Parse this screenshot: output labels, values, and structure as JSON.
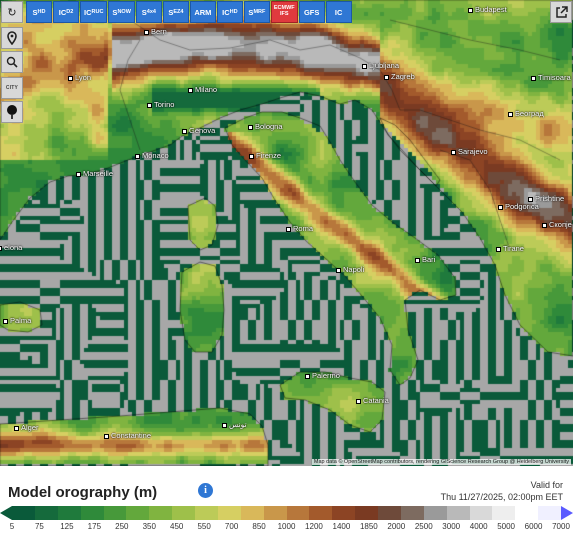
{
  "map": {
    "cities": [
      {
        "name": "Bern",
        "key": "bern"
      },
      {
        "name": "Budapest",
        "key": "budapest"
      },
      {
        "name": "Lyon",
        "key": "lyon"
      },
      {
        "name": "Milano",
        "key": "milano"
      },
      {
        "name": "Ljubljana",
        "key": "ljubljana"
      },
      {
        "name": "Zagreb",
        "key": "zagreb"
      },
      {
        "name": "Timisoara",
        "key": "timisoara"
      },
      {
        "name": "Torino",
        "key": "torino"
      },
      {
        "name": "Београд",
        "key": "beograd"
      },
      {
        "name": "Genova",
        "key": "genova"
      },
      {
        "name": "Bologna",
        "key": "bologna"
      },
      {
        "name": "Monaco",
        "key": "monaco"
      },
      {
        "name": "Firenze",
        "key": "firenze"
      },
      {
        "name": "Sarajevo",
        "key": "sarajevo"
      },
      {
        "name": "Marseille",
        "key": "marseille"
      },
      {
        "name": "Podgorica",
        "key": "podgorica"
      },
      {
        "name": "Prishtine",
        "key": "prishtine"
      },
      {
        "name": "Roma",
        "key": "roma"
      },
      {
        "name": "Скопје",
        "key": "skopje"
      },
      {
        "name": "Tirane",
        "key": "tirane"
      },
      {
        "name": "Bari",
        "key": "bari"
      },
      {
        "name": "Napoli",
        "key": "napoli"
      },
      {
        "name": "elona",
        "key": "barcelona"
      },
      {
        "name": "Palma",
        "key": "palma"
      },
      {
        "name": "Palermo",
        "key": "palermo"
      },
      {
        "name": "Catania",
        "key": "catania"
      },
      {
        "name": "Alger",
        "key": "alger"
      },
      {
        "name": "Constantine",
        "key": "constantine"
      },
      {
        "name": "تونس",
        "key": "tunis"
      }
    ],
    "attribution": "Map data © OpenStreetMap contributors, rendering GIScience Research Group @ Heidelberg University"
  },
  "toolbar": {
    "models": [
      {
        "main": "S",
        "sub": "HD",
        "active": false
      },
      {
        "main": "IC",
        "sub": "D2",
        "active": false
      },
      {
        "main": "IC",
        "sub": "RUC",
        "active": false
      },
      {
        "main": "S",
        "sub": "NOW",
        "active": false
      },
      {
        "main": "S",
        "sub": "4x4",
        "active": false
      },
      {
        "main": "S",
        "sub": "EZ4",
        "active": false
      },
      {
        "main": "ARM",
        "sub": "",
        "active": false
      },
      {
        "main": "IC",
        "sub": "HD",
        "active": false
      },
      {
        "main": "S",
        "sub": "MRF",
        "active": false
      },
      {
        "main": "ECMWF",
        "sub": "IFS",
        "active": true
      },
      {
        "main": "GFS",
        "sub": "",
        "active": false
      },
      {
        "main": "IC",
        "sub": "",
        "active": false
      }
    ],
    "city_label": "CITY"
  },
  "legend": {
    "title": "Model orography (m)",
    "valid_label": "Valid for",
    "valid_time": "Thu 11/27/2025, 02:00pm EET",
    "ticks": [
      "5",
      "75",
      "125",
      "175",
      "250",
      "350",
      "450",
      "550",
      "700",
      "850",
      "1000",
      "1200",
      "1400",
      "1850",
      "2000",
      "2500",
      "3000",
      "4000",
      "5000",
      "6000",
      "7000"
    ],
    "colors": [
      "#0a5a3a",
      "#156a3c",
      "#1f7a3c",
      "#2f8a3a",
      "#47993a",
      "#63a83c",
      "#80b440",
      "#9ec04a",
      "#bccb58",
      "#d6cf62",
      "#d9b85a",
      "#c9974a",
      "#b7773b",
      "#a35a2c",
      "#8c4424",
      "#7a3a22",
      "#6e4a3a",
      "#7d6b60",
      "#9a9a9a",
      "#b9b9b9",
      "#d9d9d9",
      "#eeeeee",
      "#ffffff",
      "#f0f0ff"
    ]
  }
}
